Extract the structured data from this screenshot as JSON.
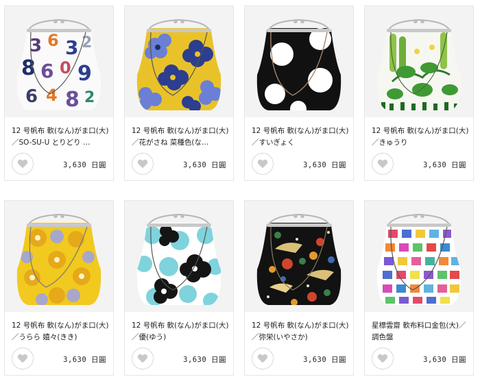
{
  "products": [
    {
      "title": "12 号帆布 軟(なん)がま口(大)／SO-SU-U とりどり …",
      "price": "3,630 日圓",
      "pattern": "numbers",
      "icon": "heart-icon"
    },
    {
      "title": "12 号帆布 軟(なん)がま口(大)／花がさね 菜種色(な…",
      "price": "3,630 日圓",
      "pattern": "flowers-yellow",
      "icon": "heart-icon"
    },
    {
      "title": "12 号帆布 軟(なん)がま口(大)／すいぎょく",
      "price": "3,630 日圓",
      "pattern": "polka-dots",
      "icon": "heart-icon"
    },
    {
      "title": "12 号帆布 軟(なん)がま口(大)／きゅうり",
      "price": "3,630 日圓",
      "pattern": "cucumber",
      "icon": "heart-icon"
    },
    {
      "title": "12 号帆布 軟(なん)がま口(大)／うらら 嬉々(きき)",
      "price": "3,630 日圓",
      "pattern": "yellow-circles",
      "icon": "heart-icon"
    },
    {
      "title": "12 号帆布 軟(なん)がま口(大)／優(ゆう)",
      "price": "3,630 日圓",
      "pattern": "blue-flowers",
      "icon": "heart-icon"
    },
    {
      "title": "12 号帆布 軟(なん)がま口(大)／弥栄(いやさか)",
      "price": "3,630 日圓",
      "pattern": "black-cranes",
      "icon": "heart-icon"
    },
    {
      "title": "星標雲齋 軟布料口金包(大)／調色盤",
      "price": "3,630 日圓",
      "pattern": "color-squares",
      "icon": "heart-icon"
    }
  ]
}
